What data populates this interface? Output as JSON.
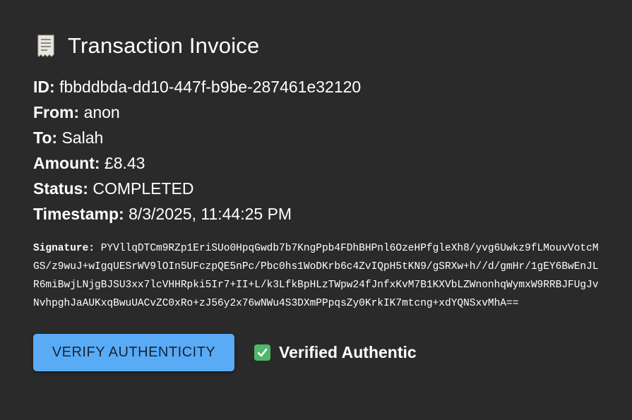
{
  "invoice": {
    "title": "Transaction Invoice",
    "title_icon": "receipt-icon",
    "fields": [
      {
        "label": "ID:",
        "value": "fbbddbda-dd10-447f-b9be-287461e32120"
      },
      {
        "label": "From:",
        "value": "anon"
      },
      {
        "label": "To:",
        "value": "Salah"
      },
      {
        "label": "Amount:",
        "value": "£8.43"
      },
      {
        "label": "Status:",
        "value": "COMPLETED"
      },
      {
        "label": "Timestamp:",
        "value": "8/3/2025, 11:44:25 PM"
      }
    ],
    "signature": {
      "label": "Signature:",
      "value": "PYVllqDTCm9RZp1EriSUo0HpqGwdb7b7KngPpb4FDhBHPnl6OzeHPfgleXh8/yvg6Uwkz9fLMouvVotcMGS/z9wuJ+wIgqUESrWV9lOIn5UFczpQE5nPc/Pbc0hs1WoDKrb6c4ZvIQpH5tKN9/gSRXw+h//d/gmHr/1gEY6BwEnJLR6miBwjLNjgBJSU3xx7lcVHHRpki5Ir7+II+L/k3LfkBpHLzTWpw24fJnfxKvM7B1KXVbLZWnonhqWymxW9RRBJFUgJvNvhpghJaAUKxqBwuUACvZC0xRo+zJ56y2x76wNWu4S3DXmPPpqsZy0KrkIK7mtcng+xdYQNSxvMhA=="
    }
  },
  "actions": {
    "verify_label": "VERIFY AUTHENTICITY",
    "status_icon": "check-icon",
    "status_text": "Verified Authentic"
  },
  "colors": {
    "background": "#2a2a2b",
    "button": "#5aabf5",
    "check": "#4fb86b"
  }
}
